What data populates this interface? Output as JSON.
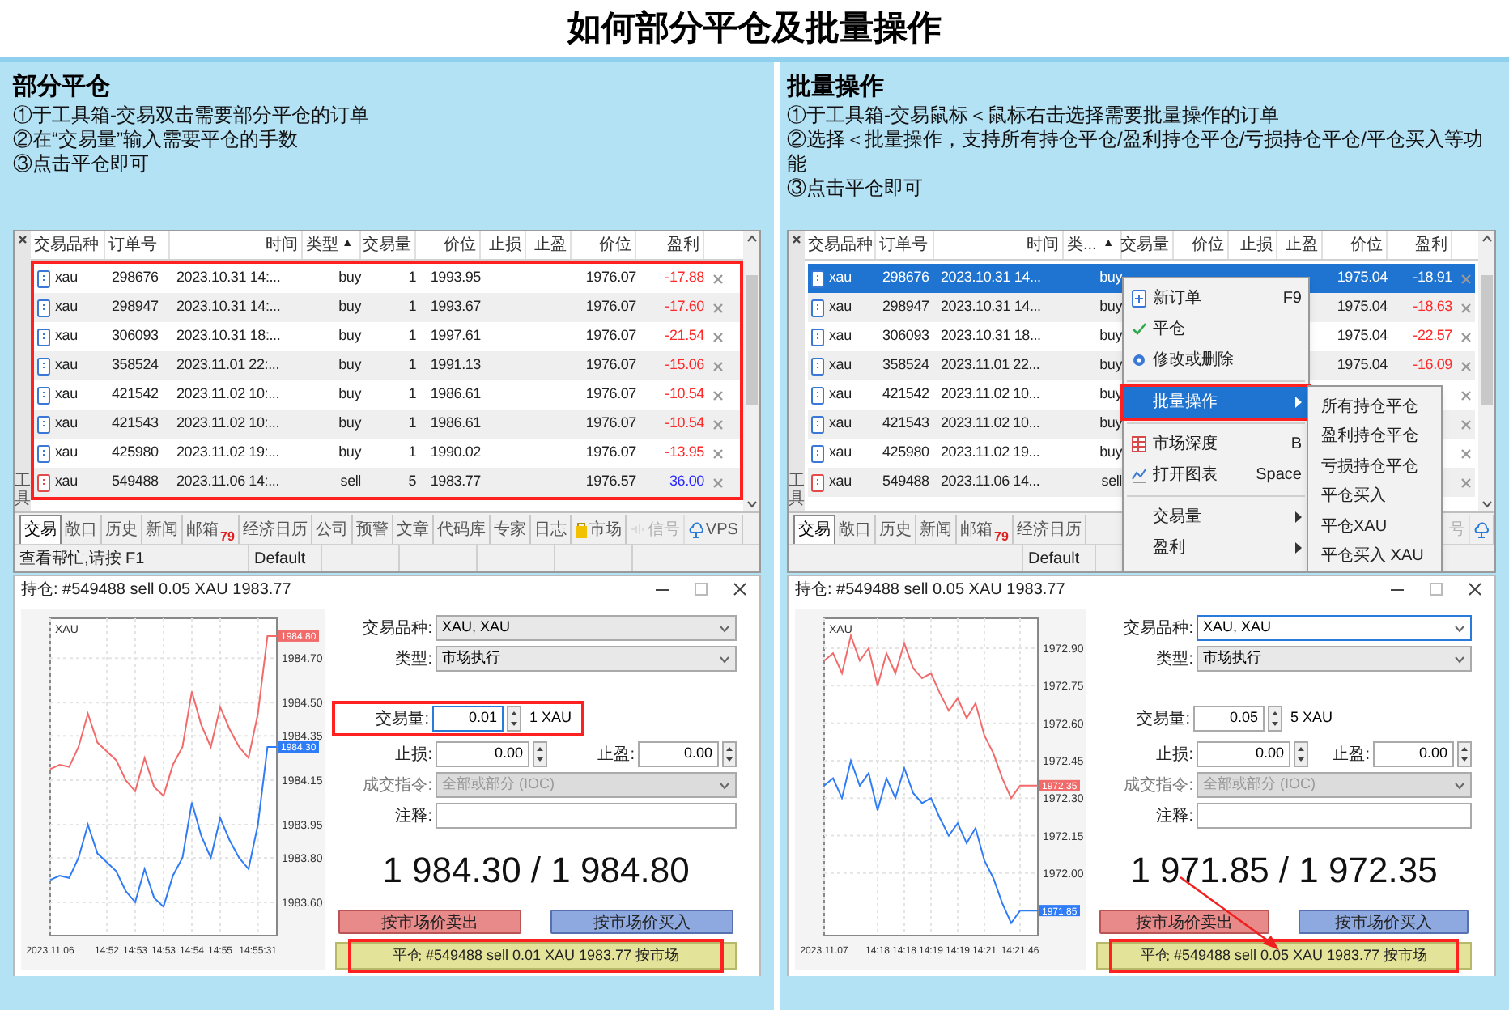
{
  "title": "如何部分平仓及批量操作",
  "sections": [
    {
      "heading": "部分平仓",
      "steps": [
        "①于工具箱-交易双击需要部分平仓的订单",
        "②在“交易量”输入需要平仓的手数",
        "③点击平仓即可"
      ],
      "terminal": {
        "gutter_label": "工具",
        "columns": [
          {
            "label": "交易品种"
          },
          {
            "label": "订单号"
          },
          {
            "label": "时间"
          },
          {
            "label": "类型",
            "sort_mark": "▲"
          },
          {
            "label": "交易量"
          },
          {
            "label": "价位"
          },
          {
            "label": "止损"
          },
          {
            "label": "止盈"
          },
          {
            "label": "价位"
          },
          {
            "label": "盈利"
          }
        ],
        "rows_highlighted": true,
        "rows": [
          {
            "kind": "buy",
            "symbol": "xau",
            "order": "298676",
            "time": "2023.10.31 14:...",
            "type": "buy",
            "volume": "1",
            "open_price": "1993.95",
            "price": "1976.07",
            "profit": "-17.88",
            "color": "#ff2a2a",
            "selected": false
          },
          {
            "kind": "buy",
            "symbol": "xau",
            "order": "298947",
            "time": "2023.10.31 14:...",
            "type": "buy",
            "volume": "1",
            "open_price": "1993.67",
            "price": "1976.07",
            "profit": "-17.60",
            "color": "#ff2a2a",
            "selected": false
          },
          {
            "kind": "buy",
            "symbol": "xau",
            "order": "306093",
            "time": "2023.10.31 18:...",
            "type": "buy",
            "volume": "1",
            "open_price": "1997.61",
            "price": "1976.07",
            "profit": "-21.54",
            "color": "#ff2a2a",
            "selected": false
          },
          {
            "kind": "buy",
            "symbol": "xau",
            "order": "358524",
            "time": "2023.11.01 22:...",
            "type": "buy",
            "volume": "1",
            "open_price": "1991.13",
            "price": "1976.07",
            "profit": "-15.06",
            "color": "#ff2a2a",
            "selected": false
          },
          {
            "kind": "buy",
            "symbol": "xau",
            "order": "421542",
            "time": "2023.11.02 10:...",
            "type": "buy",
            "volume": "1",
            "open_price": "1986.61",
            "price": "1976.07",
            "profit": "-10.54",
            "color": "#ff2a2a",
            "selected": false
          },
          {
            "kind": "buy",
            "symbol": "xau",
            "order": "421543",
            "time": "2023.11.02 10:...",
            "type": "buy",
            "volume": "1",
            "open_price": "1986.61",
            "price": "1976.07",
            "profit": "-10.54",
            "color": "#ff2a2a",
            "selected": false
          },
          {
            "kind": "buy",
            "symbol": "xau",
            "order": "425980",
            "time": "2023.11.02 19:...",
            "type": "buy",
            "volume": "1",
            "open_price": "1990.02",
            "price": "1976.07",
            "profit": "-13.95",
            "color": "#ff2a2a",
            "selected": false
          },
          {
            "kind": "sell",
            "symbol": "xau",
            "order": "549488",
            "time": "2023.11.06 14:...",
            "type": "sell",
            "volume": "5",
            "open_price": "1983.77",
            "price": "1976.57",
            "profit": "36.00",
            "color": "#2a2aff",
            "selected": false
          }
        ],
        "tabs": [
          {
            "kind": "text",
            "label": "交易",
            "selected": true,
            "disabled": false
          },
          {
            "kind": "text",
            "label": "敞口",
            "selected": false,
            "disabled": false
          },
          {
            "kind": "text",
            "label": "历史",
            "selected": false,
            "disabled": false
          },
          {
            "kind": "text",
            "label": "新闻",
            "selected": false,
            "disabled": false
          },
          {
            "kind": "text",
            "label": "邮箱",
            "badge": "79",
            "selected": false,
            "disabled": false
          },
          {
            "kind": "text",
            "label": "经济日历",
            "selected": false,
            "disabled": false
          },
          {
            "kind": "text",
            "label": "公司",
            "selected": false,
            "disabled": false
          },
          {
            "kind": "text",
            "label": "预警",
            "selected": false,
            "disabled": false
          },
          {
            "kind": "text",
            "label": "文章",
            "selected": false,
            "disabled": false
          },
          {
            "kind": "text",
            "label": "代码库",
            "selected": false,
            "disabled": false
          },
          {
            "kind": "text",
            "label": "专家",
            "selected": false,
            "disabled": false
          },
          {
            "kind": "text",
            "label": "日志",
            "selected": false,
            "disabled": false
          },
          {
            "kind": "market",
            "label": "市场",
            "selected": false,
            "disabled": false
          },
          {
            "kind": "signal",
            "label": "信号",
            "selected": false,
            "disabled": true
          },
          {
            "kind": "vps",
            "label": "VPS",
            "selected": false,
            "disabled": false
          }
        ],
        "status_bar": {
          "help": "查看帮忙,请按 F1",
          "profile": "Default"
        }
      },
      "dialog": {
        "title": "持仓: #549488 sell 0.05 XAU 1983.77",
        "chart_data": {
          "type": "line",
          "title": "XAU",
          "categories": [
            "2023.11.06",
            null,
            null,
            null,
            null,
            null,
            "14:52",
            null,
            null,
            "14:53",
            null,
            null,
            "14:53",
            null,
            null,
            "14:54",
            null,
            null,
            "14:55",
            null,
            null,
            null,
            "14:55:31",
            null,
            null
          ],
          "series": [
            {
              "color": "#f26b6b",
              "values": [
                1984.2,
                1984.22,
                1984.21,
                1984.3,
                1984.45,
                1984.32,
                1984.28,
                1984.24,
                1984.15,
                1984.1,
                1984.25,
                1984.12,
                1984.08,
                1984.22,
                1984.3,
                1984.55,
                1984.4,
                1984.3,
                1984.48,
                1984.38,
                1984.3,
                1984.25,
                1984.45,
                1984.8,
                1984.8
              ]
            },
            {
              "color": "#2f7cf6",
              "values": [
                1983.7,
                1983.72,
                1983.71,
                1983.8,
                1983.95,
                1983.82,
                1983.78,
                1983.74,
                1983.65,
                1983.6,
                1983.75,
                1983.62,
                1983.58,
                1983.72,
                1983.8,
                1984.05,
                1983.9,
                1983.8,
                1983.98,
                1983.88,
                1983.8,
                1983.75,
                1983.95,
                1984.3,
                1984.3
              ]
            }
          ],
          "ylim": [
            1983.45,
            1984.88
          ],
          "yticks": [
            {
              "value": 1984.7,
              "label": "1984.70"
            },
            {
              "value": 1984.5,
              "label": "1984.50"
            },
            {
              "value": 1984.35,
              "label": "1984.35"
            },
            {
              "value": 1984.15,
              "label": "1984.15"
            },
            {
              "value": 1983.95,
              "label": "1983.95"
            },
            {
              "value": 1983.8,
              "label": "1983.80"
            },
            {
              "value": 1983.6,
              "label": "1983.60"
            }
          ],
          "annotations": [
            "1984.80",
            "1984.30"
          ],
          "grid": true
        },
        "symbol": {
          "label": "交易品种:",
          "value": "XAU, XAU",
          "focused": false
        },
        "order_type": {
          "label": "类型:",
          "value": "市场执行"
        },
        "volume": {
          "label": "交易量:",
          "value": "0.01",
          "unit": "1 XAU",
          "focused": true,
          "highlighted": true
        },
        "stop_loss": {
          "label": "止损:",
          "value": "0.00"
        },
        "take_profit": {
          "label": "止盈:",
          "value": "0.00"
        },
        "fill_policy": {
          "label": "成交指令:",
          "value": "全部或部分 (IOC)",
          "disabled": true
        },
        "comment": {
          "label": "注释:"
        },
        "quote": "1 984.30 / 1 984.80",
        "sell_button": "按市场价卖出",
        "buy_button": "按市场价买入",
        "close_button": {
          "label": "平仓 #549488 sell 0.01 XAU 1983.77 按市场",
          "highlighted": true
        }
      }
    },
    {
      "heading": "批量操作",
      "steps": [
        "①于工具箱-交易鼠标＜鼠标右击选择需要批量操作的订单",
        "②选择＜批量操作，支持所有持仓平仓/盈利持仓平仓/亏损持仓平仓/平仓买入等功能",
        "③点击平仓即可"
      ],
      "terminal": {
        "gutter_label": "工具",
        "columns": [
          {
            "label": "交易品种"
          },
          {
            "label": "订单号"
          },
          {
            "label": "时间"
          },
          {
            "label": "类...",
            "sort_mark": "▲"
          },
          {
            "label": "交易量"
          },
          {
            "label": "价位"
          },
          {
            "label": "止损"
          },
          {
            "label": "止盈"
          },
          {
            "label": "价位"
          },
          {
            "label": "盈利"
          }
        ],
        "rows": [
          {
            "kind": "buy",
            "symbol": "xau",
            "order": "298676",
            "time": "2023.10.31 14...",
            "type": "buy",
            "price": "1975.04",
            "profit": "-18.91",
            "selected": true
          },
          {
            "kind": "buy",
            "symbol": "xau",
            "order": "298947",
            "time": "2023.10.31 14...",
            "type": "buy",
            "price": "1975.04",
            "profit": "-18.63",
            "color": "#ff2a2a",
            "selected": false
          },
          {
            "kind": "buy",
            "symbol": "xau",
            "order": "306093",
            "time": "2023.10.31 18...",
            "type": "buy",
            "price": "1975.04",
            "profit": "-22.57",
            "color": "#ff2a2a",
            "selected": false
          },
          {
            "kind": "buy",
            "symbol": "xau",
            "order": "358524",
            "time": "2023.11.01 22...",
            "type": "buy",
            "price": "1975.04",
            "profit": "-16.09",
            "color": "#ff2a2a",
            "selected": false
          },
          {
            "kind": "buy",
            "symbol": "xau",
            "order": "421542",
            "time": "2023.11.02 10...",
            "type": "buy",
            "selected": false
          },
          {
            "kind": "buy",
            "symbol": "xau",
            "order": "421543",
            "time": "2023.11.02 10...",
            "type": "buy",
            "selected": false
          },
          {
            "kind": "buy",
            "symbol": "xau",
            "order": "425980",
            "time": "2023.11.02 19...",
            "type": "buy",
            "selected": false
          },
          {
            "kind": "sell",
            "symbol": "xau",
            "order": "549488",
            "time": "2023.11.06 14...",
            "type": "sell",
            "selected": false
          }
        ],
        "tabs": [
          {
            "kind": "text",
            "label": "交易",
            "selected": true,
            "disabled": false
          },
          {
            "kind": "text",
            "label": "敞口",
            "selected": false,
            "disabled": false
          },
          {
            "kind": "text",
            "label": "历史",
            "selected": false,
            "disabled": false
          },
          {
            "kind": "text",
            "label": "新闻",
            "selected": false,
            "disabled": false
          },
          {
            "kind": "text",
            "label": "邮箱",
            "badge": "79",
            "selected": false,
            "disabled": false
          },
          {
            "kind": "text",
            "label": "经济日历",
            "selected": false,
            "disabled": false
          },
          {
            "kind": "text",
            "label": "号",
            "selected": false,
            "disabled": true
          },
          {
            "kind": "vps",
            "selected": false,
            "disabled": false
          }
        ],
        "status_bar": {
          "profile": "Default"
        },
        "context_menu": {
          "items": [
            {
              "kind": "item",
              "label": "新订单",
              "shortcut": "F9",
              "selected": false,
              "highlighted": false
            },
            {
              "kind": "item",
              "label": "平仓",
              "selected": false,
              "highlighted": false
            },
            {
              "kind": "item",
              "label": "修改或删除",
              "selected": false,
              "highlighted": false
            },
            {
              "kind": "separator"
            },
            {
              "kind": "submenu",
              "label": "批量操作",
              "selected": true,
              "highlighted": true
            },
            {
              "kind": "separator"
            },
            {
              "kind": "item",
              "label": "市场深度",
              "shortcut": "B",
              "selected": false,
              "highlighted": false
            },
            {
              "kind": "item",
              "label": "打开图表",
              "shortcut": "Space",
              "selected": false,
              "highlighted": false
            },
            {
              "kind": "separator"
            },
            {
              "kind": "submenu",
              "label": "交易量",
              "selected": false,
              "highlighted": false
            },
            {
              "kind": "submenu",
              "label": "盈利",
              "selected": false,
              "highlighted": false
            }
          ],
          "submenu": [
            "所有持仓平仓",
            "盈利持仓平仓",
            "亏损持仓平仓",
            "平仓买入",
            "平仓XAU",
            "平仓买入 XAU"
          ]
        }
      },
      "dialog": {
        "title": "持仓: #549488 sell 0.05 XAU 1983.77",
        "chart_data": {
          "type": "line",
          "title": "XAU",
          "categories": [
            "2023.11.07",
            null,
            null,
            null,
            null,
            null,
            "14:18",
            null,
            null,
            "14:18",
            null,
            null,
            "14:19",
            null,
            null,
            "14:19",
            null,
            null,
            "14:21",
            null,
            null,
            null,
            "14:21:46",
            null,
            null
          ],
          "series": [
            {
              "color": "#f26b6b",
              "values": [
                1972.85,
                1972.88,
                1972.8,
                1972.95,
                1972.85,
                1972.9,
                1972.75,
                1972.88,
                1972.8,
                1972.92,
                1972.82,
                1972.78,
                1972.8,
                1972.72,
                1972.65,
                1972.7,
                1972.62,
                1972.68,
                1972.55,
                1972.48,
                1972.38,
                1972.3,
                1972.35,
                1972.35,
                1972.35
              ]
            },
            {
              "color": "#2f7cf6",
              "values": [
                1972.35,
                1972.38,
                1972.3,
                1972.45,
                1972.35,
                1972.4,
                1972.25,
                1972.38,
                1972.3,
                1972.42,
                1972.32,
                1972.28,
                1972.3,
                1972.22,
                1972.15,
                1972.2,
                1972.12,
                1972.18,
                1972.05,
                1971.98,
                1971.88,
                1971.8,
                1971.85,
                1971.85,
                1971.85
              ]
            }
          ],
          "ylim": [
            1971.75,
            1973.02
          ],
          "yticks": [
            {
              "value": 1972.9,
              "label": "1972.90"
            },
            {
              "value": 1972.75,
              "label": "1972.75"
            },
            {
              "value": 1972.6,
              "label": "1972.60"
            },
            {
              "value": 1972.45,
              "label": "1972.45"
            },
            {
              "value": 1972.3,
              "label": "1972.30"
            },
            {
              "value": 1972.15,
              "label": "1972.15"
            },
            {
              "value": 1972.0,
              "label": "1972.00"
            }
          ],
          "annotations": [
            "1972.35",
            "1971.85"
          ],
          "grid": true
        },
        "symbol": {
          "label": "交易品种:",
          "value": "XAU, XAU",
          "focused": true
        },
        "order_type": {
          "label": "类型:",
          "value": "市场执行"
        },
        "volume": {
          "label": "交易量:",
          "value": "0.05",
          "unit": "5 XAU",
          "focused": false,
          "highlighted": false
        },
        "stop_loss": {
          "label": "止损:",
          "value": "0.00"
        },
        "take_profit": {
          "label": "止盈:",
          "value": "0.00"
        },
        "fill_policy": {
          "label": "成交指令:",
          "value": "全部或部分 (IOC)",
          "disabled": true
        },
        "comment": {
          "label": "注释:"
        },
        "quote": "1 971.85 / 1 972.35",
        "sell_button": "按市场价卖出",
        "buy_button": "按市场价买入",
        "close_button": {
          "label": "平仓 #549488 sell 0.05 XAU 1983.77 按市场",
          "highlighted": true
        },
        "pointer_arrow": true
      }
    }
  ]
}
